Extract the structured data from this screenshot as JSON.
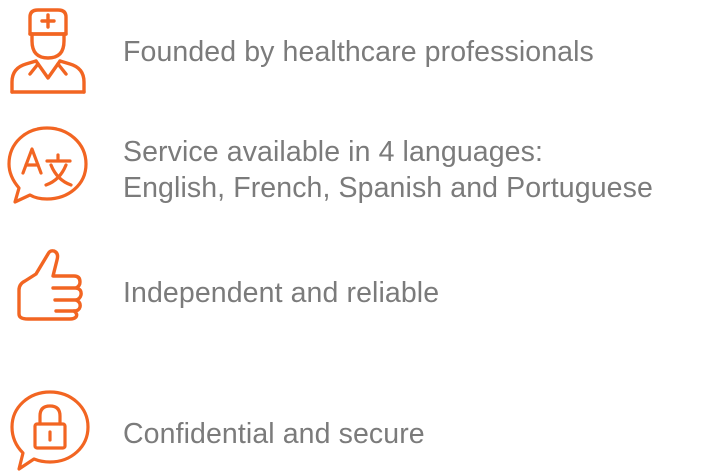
{
  "accent_color": "#f26522",
  "text_color": "#7b7b7b",
  "features": [
    {
      "icon": "doctor-icon",
      "lines": [
        "Founded by healthcare professionals"
      ]
    },
    {
      "icon": "translate-speech-bubble-icon",
      "lines": [
        "Service available in 4 languages:",
        "English, French, Spanish and Portuguese"
      ]
    },
    {
      "icon": "thumbs-up-icon",
      "lines": [
        "Independent and reliable"
      ]
    },
    {
      "icon": "lock-speech-bubble-icon",
      "lines": [
        "Confidential and secure"
      ]
    }
  ]
}
